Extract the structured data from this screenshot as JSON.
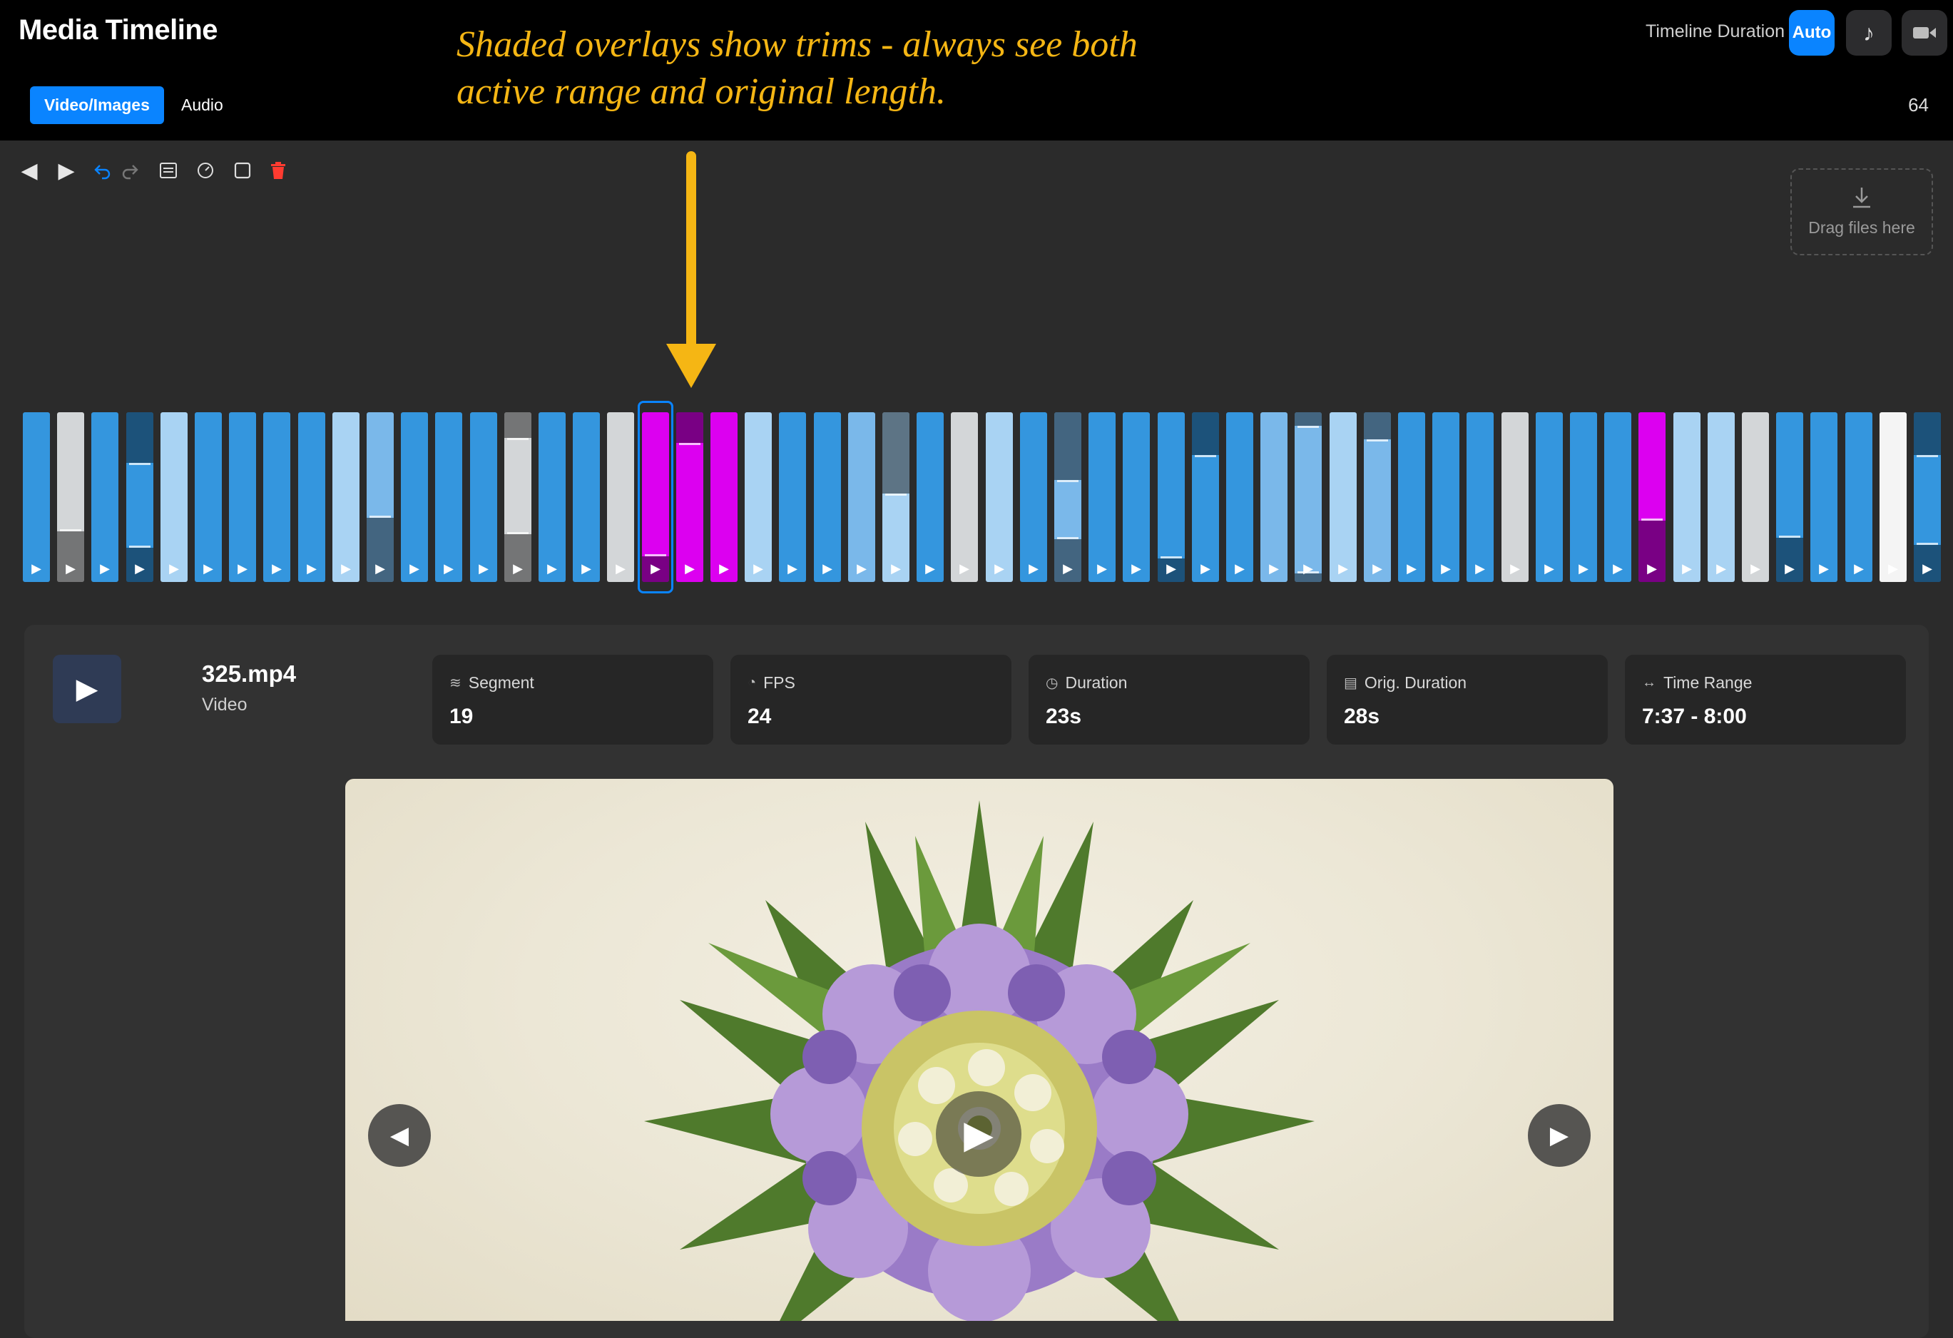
{
  "app": {
    "title": "Media Timeline",
    "tabs": [
      {
        "label": "Video/Images",
        "active": true
      },
      {
        "label": "Audio",
        "active": false
      }
    ],
    "timeline_duration_label": "Timeline Duration",
    "auto_label": "Auto",
    "clip_count": "64"
  },
  "annotation": {
    "text_line1": "Shaded overlays show trims - always see both",
    "text_line2": "active range and original length."
  },
  "toolbar": {
    "icons": [
      "previous-icon",
      "play-icon",
      "undo-icon",
      "redo-icon",
      "list-icon",
      "speed-icon",
      "square-icon",
      "trash-icon"
    ]
  },
  "dropzone": {
    "label": "Drag files here"
  },
  "colors": {
    "accent": "#0a84ff",
    "annotation": "#f5b614",
    "blue": "#3496de",
    "light_blue": "#a9d3f3",
    "sky": "#7ab8ea",
    "gray": "#d3d6d8",
    "magenta": "#dc00f0",
    "white": "#f4f4f4"
  },
  "clips": [
    {
      "color": "blue"
    },
    {
      "color": "gray",
      "trim": 0.3
    },
    {
      "color": "blue"
    },
    {
      "color": "blue",
      "trim_top": 0.3,
      "trim": 0.2
    },
    {
      "color": "light_blue"
    },
    {
      "color": "blue"
    },
    {
      "color": "blue"
    },
    {
      "color": "blue"
    },
    {
      "color": "blue"
    },
    {
      "color": "light_blue"
    },
    {
      "color": "sky",
      "trim": 0.38
    },
    {
      "color": "blue"
    },
    {
      "color": "blue"
    },
    {
      "color": "blue"
    },
    {
      "color": "gray",
      "trim_top": 0.15,
      "trim": 0.28
    },
    {
      "color": "blue"
    },
    {
      "color": "blue"
    },
    {
      "color": "gray"
    },
    {
      "color": "magenta",
      "trim": 0.15,
      "selected": true
    },
    {
      "color": "magenta",
      "trim_top": 0.18
    },
    {
      "color": "magenta"
    },
    {
      "color": "light_blue"
    },
    {
      "color": "blue"
    },
    {
      "color": "blue"
    },
    {
      "color": "sky"
    },
    {
      "color": "light_blue",
      "trim_top": 0.48
    },
    {
      "color": "blue"
    },
    {
      "color": "gray"
    },
    {
      "color": "light_blue"
    },
    {
      "color": "blue"
    },
    {
      "color": "sky",
      "trim_top": 0.4,
      "trim": 0.25
    },
    {
      "color": "blue"
    },
    {
      "color": "blue"
    },
    {
      "color": "blue",
      "trim": 0.14
    },
    {
      "color": "blue",
      "trim_top": 0.25
    },
    {
      "color": "blue"
    },
    {
      "color": "sky"
    },
    {
      "color": "sky",
      "trim_top": 0.08,
      "trim": 0.05
    },
    {
      "color": "light_blue"
    },
    {
      "color": "sky",
      "trim_top": 0.16
    },
    {
      "color": "blue"
    },
    {
      "color": "blue"
    },
    {
      "color": "blue"
    },
    {
      "color": "gray"
    },
    {
      "color": "blue"
    },
    {
      "color": "blue"
    },
    {
      "color": "blue"
    },
    {
      "color": "magenta",
      "trim": 0.36
    },
    {
      "color": "light_blue"
    },
    {
      "color": "light_blue"
    },
    {
      "color": "gray"
    },
    {
      "color": "blue",
      "trim": 0.26
    },
    {
      "color": "blue"
    },
    {
      "color": "blue"
    },
    {
      "color": "white"
    },
    {
      "color": "blue",
      "trim_top": 0.25,
      "trim": 0.22
    },
    {
      "color": "white"
    }
  ],
  "details": {
    "file_name": "325.mp4",
    "file_type": "Video",
    "stats": [
      {
        "label": "Segment",
        "value": "19",
        "icon": "layers-icon",
        "glyph": "≋"
      },
      {
        "label": "FPS",
        "value": "24",
        "icon": "gauge-icon",
        "glyph": "◔"
      },
      {
        "label": "Duration",
        "value": "23s",
        "icon": "clock-icon",
        "glyph": "◷"
      },
      {
        "label": "Orig. Duration",
        "value": "28s",
        "icon": "film-icon",
        "glyph": "▤"
      },
      {
        "label": "Time Range",
        "value": "7:37 - 8:00",
        "icon": "arrows-horizontal-icon",
        "glyph": "↔"
      }
    ]
  }
}
